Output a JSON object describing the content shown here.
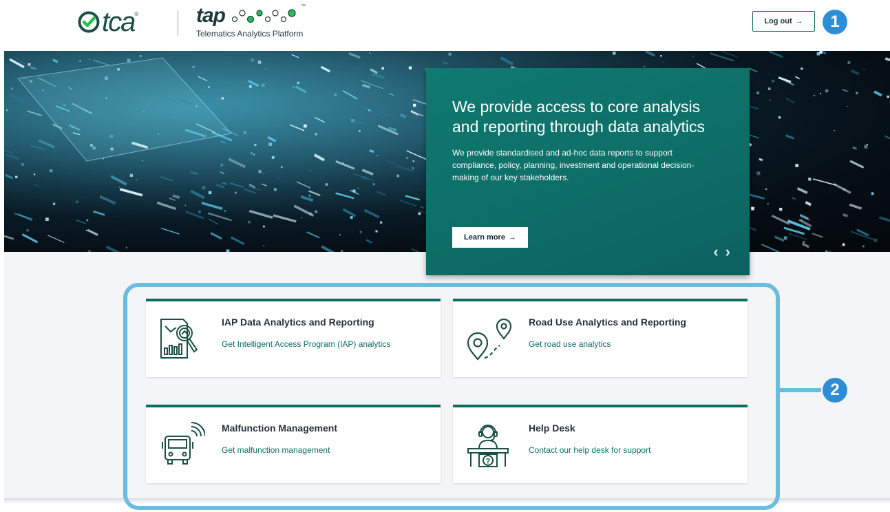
{
  "header": {
    "tca_logo_text": "tca",
    "tca_registered_mark": "®",
    "tap_logo_text": "tap",
    "tap_trademark": "™",
    "platform_name": "Telematics Analytics Platform",
    "logout_label": "Log out",
    "logout_arrow": "→"
  },
  "badges": {
    "one": "1",
    "two": "2"
  },
  "hero": {
    "heading": "We provide access to core analysis and reporting through data analytics",
    "body": "We provide standardised and ad-hoc data reports to support compliance, policy, planning, investment and operational decision-making of our key stakeholders.",
    "cta_label": "Learn more",
    "cta_arrow": "→",
    "prev_glyph": "‹",
    "next_glyph": "›"
  },
  "cards": [
    {
      "title": "IAP Data Analytics and Reporting",
      "description": "Get Intelligent Access Program (IAP) analytics",
      "icon": "analytics-report-icon"
    },
    {
      "title": "Road Use Analytics and Reporting",
      "description": "Get road use analytics",
      "icon": "map-route-icon"
    },
    {
      "title": "Malfunction Management",
      "description": "Get malfunction management",
      "icon": "connected-truck-icon"
    },
    {
      "title": "Help Desk",
      "description": "Contact our help desk for support",
      "icon": "help-desk-icon"
    }
  ],
  "colors": {
    "brand_teal": "#0b6d62",
    "panel_teal": "#0d6d66",
    "highlight_blue": "#6bbde0",
    "badge_blue": "#2d8ed6",
    "logo_green": "#1b4e44",
    "dot_green": "#22c24a"
  }
}
